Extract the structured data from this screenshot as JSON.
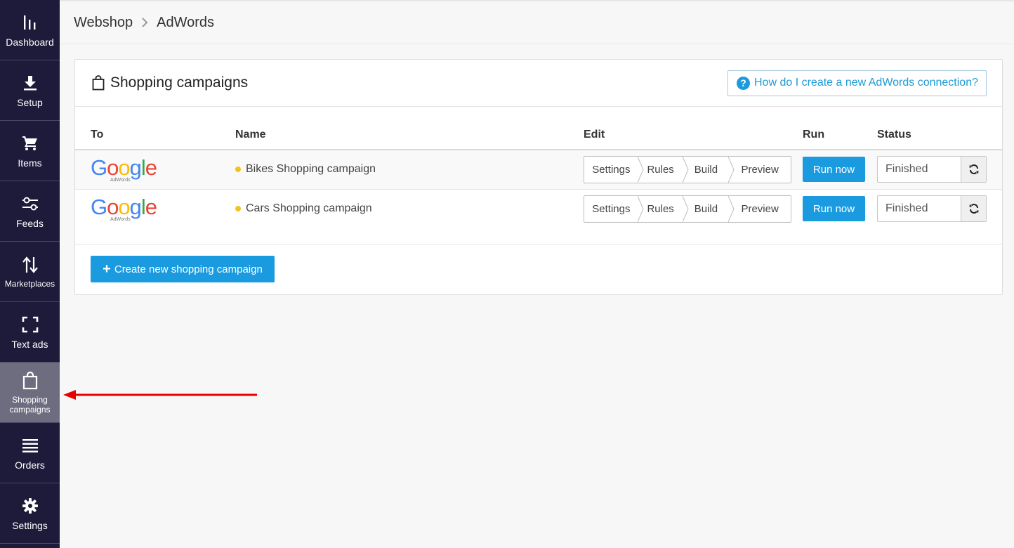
{
  "sidebar": {
    "items": [
      {
        "label": "Dashboard",
        "icon": "bar-chart-icon"
      },
      {
        "label": "Setup",
        "icon": "download-icon"
      },
      {
        "label": "Items",
        "icon": "cart-icon"
      },
      {
        "label": "Feeds",
        "icon": "sliders-icon"
      },
      {
        "label": "Marketplaces",
        "icon": "sort-arrows-icon"
      },
      {
        "label": "Text ads",
        "icon": "frame-corners-icon"
      },
      {
        "label": "Shopping campaigns",
        "icon": "shopping-bag-icon",
        "active": true
      },
      {
        "label": "Orders",
        "icon": "list-icon"
      },
      {
        "label": "Settings",
        "icon": "gear-icon"
      }
    ]
  },
  "breadcrumb": {
    "root": "Webshop",
    "current": "AdWords"
  },
  "panel": {
    "title": "Shopping campaigns",
    "help_label": "How do I create a new AdWords connection?",
    "columns": {
      "to": "To",
      "name": "Name",
      "edit": "Edit",
      "run": "Run",
      "status": "Status"
    },
    "rows": [
      {
        "logo": "Google",
        "logo_sub": "AdWords",
        "name": "Bikes Shopping campaign",
        "steps": [
          "Settings",
          "Rules",
          "Build",
          "Preview"
        ],
        "run": "Run now",
        "status": "Finished"
      },
      {
        "logo": "Google",
        "logo_sub": "AdWords",
        "name": "Cars Shopping campaign",
        "steps": [
          "Settings",
          "Rules",
          "Build",
          "Preview"
        ],
        "run": "Run now",
        "status": "Finished"
      }
    ],
    "create_label": "Create new shopping campaign"
  },
  "colors": {
    "sidebar": "#1d1a3a",
    "active": "#6e6d80",
    "accent": "#1a9be0",
    "dot": "#f5c219",
    "arrow": "#e60000"
  }
}
